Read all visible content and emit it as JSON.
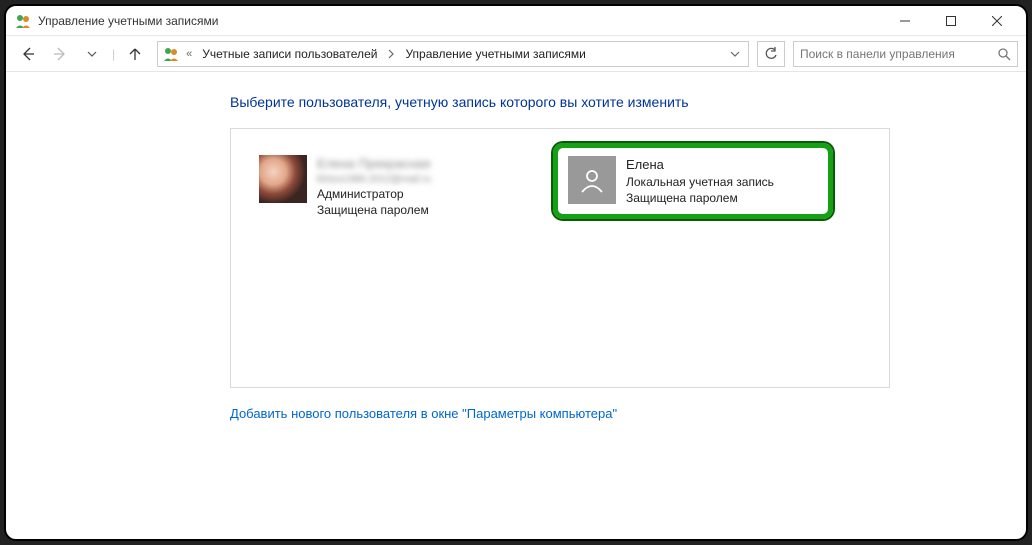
{
  "window": {
    "title": "Управление учетными записями"
  },
  "navbar": {
    "chevrons": "«",
    "breadcrumbs": [
      "Учетные записи пользователей",
      "Управление учетными записями"
    ],
    "search_placeholder": "Поиск в панели управления"
  },
  "content": {
    "heading": "Выберите пользователя, учетную запись которого вы хотите изменить",
    "users": [
      {
        "name": "Елена Прекрасная",
        "email": "blotus1986.2012@mail.ru",
        "role": "Администратор",
        "protection": "Защищена паролем",
        "highlight": false,
        "avatar": "photo"
      },
      {
        "name": "Елена",
        "type": "Локальная учетная запись",
        "protection": "Защищена паролем",
        "highlight": true,
        "avatar": "placeholder"
      }
    ],
    "add_user_link": "Добавить нового пользователя в окне \"Параметры компьютера\""
  }
}
